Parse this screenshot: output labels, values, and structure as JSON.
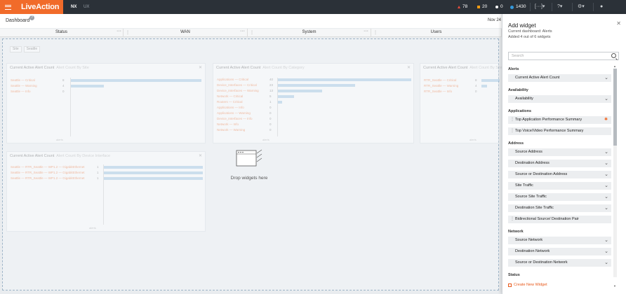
{
  "app": {
    "logo": "LiveAction"
  },
  "topbar": {
    "nav": [
      "NX",
      "UX"
    ],
    "stats": [
      {
        "icon": "alert-triangle-icon",
        "value": "78",
        "color": "#e74c3c"
      },
      {
        "icon": "warning-square-icon",
        "value": "20",
        "color": "#f39c12"
      },
      {
        "icon": "info-circle-icon",
        "value": "0",
        "color": "#ffffff"
      },
      {
        "icon": "users-icon",
        "value": "1430",
        "color": "#3498db"
      }
    ],
    "icons": [
      "expand-icon",
      "help-icon",
      "gear-icon",
      "user-icon"
    ]
  },
  "dashboard": {
    "title": "Dashboard",
    "date": "Nov 24",
    "tabs": [
      "Status",
      "WAN",
      "System",
      "Users"
    ],
    "filters": [
      "Site",
      "Seattle"
    ],
    "drop_text": "Drop widgets here",
    "widgets": [
      {
        "title": "Current Active Alert Count",
        "subtitle": "Alert Count By Site",
        "rows": [
          {
            "label": "Seattle — Critical",
            "value": "8",
            "bar": 1.0
          },
          {
            "label": "Seattle — Warning",
            "value": "4",
            "bar": 0.25
          },
          {
            "label": "Seattle — Info",
            "value": "0",
            "bar": 0.0
          }
        ],
        "footer": "alerts"
      },
      {
        "title": "Current Active Alert Count",
        "subtitle": "Alert Count By Category",
        "rows": [
          {
            "label": "Applications — Critical",
            "value": "40",
            "bar": 1.0
          },
          {
            "label": "Device_Interfaces — Critical",
            "value": "23",
            "bar": 0.58
          },
          {
            "label": "Device_Interfaces — Warning",
            "value": "13",
            "bar": 0.33
          },
          {
            "label": "Network — Critical",
            "value": "5",
            "bar": 0.12
          },
          {
            "label": "Routers — Critical",
            "value": "1",
            "bar": 0.03
          },
          {
            "label": "Applications — Info",
            "value": "0",
            "bar": 0.0
          },
          {
            "label": "Applications — Warning",
            "value": "0",
            "bar": 0.0
          },
          {
            "label": "Device_Interfaces — Info",
            "value": "0",
            "bar": 0.0
          },
          {
            "label": "Network — Info",
            "value": "0",
            "bar": 0.0
          },
          {
            "label": "Network — Warning",
            "value": "0",
            "bar": 0.0
          }
        ],
        "footer": "alerts"
      },
      {
        "title": "Current Active Alert Count",
        "subtitle": "Alert Count By Site",
        "rows": [
          {
            "label": "RTR_Seattle — Critical",
            "value": "8",
            "bar": 1.0
          },
          {
            "label": "RTR_Seattle — Warning",
            "value": "4",
            "bar": 0.3
          },
          {
            "label": "RTR_Seattle — Info",
            "value": "0",
            "bar": 0.0
          }
        ],
        "footer": "alerts"
      },
      {
        "title": "Current Active Alert Count",
        "subtitle": "Alert Count By Device Interface",
        "rows": [
          {
            "label": "Seattle — RTR_Seattle — WP1.2 — GigabitEthernet",
            "value": "1",
            "bar": 1.0
          },
          {
            "label": "Seattle — RTR_Seattle — WP1.2 — GigabitEthernet",
            "value": "1",
            "bar": 1.0
          },
          {
            "label": "Seattle — RTR_Seattle — WP1.2 — GigabitEthernet",
            "value": "1",
            "bar": 1.0
          }
        ],
        "footer": "alerts"
      }
    ]
  },
  "panel": {
    "title": "Add widget",
    "current_dashboard": "Current dashboard: Alerts",
    "added": "Added 4 out of 6 widgets",
    "search_placeholder": "Search",
    "create_label": "Create New Widget",
    "groups": [
      {
        "category": "Alerts",
        "items": [
          {
            "label": "Current Active Alert Count",
            "kind": "dropdown"
          }
        ]
      },
      {
        "category": "Availability",
        "items": [
          {
            "label": "Availability",
            "kind": "dropdown"
          }
        ]
      },
      {
        "category": "Applications",
        "items": [
          {
            "label": "Top Application Performance Summary",
            "kind": "starred"
          },
          {
            "label": "Top Voice/Video Performance Summary",
            "kind": "draggable"
          }
        ]
      },
      {
        "category": "Address",
        "items": [
          {
            "label": "Source Address",
            "kind": "dropdown"
          },
          {
            "label": "Destination Address",
            "kind": "dropdown"
          },
          {
            "label": "Source or Destination Address",
            "kind": "dropdown"
          },
          {
            "label": "Site Traffic",
            "kind": "dropdown"
          },
          {
            "label": "Source Site Traffic",
            "kind": "dropdown"
          },
          {
            "label": "Destination Site Traffic",
            "kind": "dropdown"
          },
          {
            "label": "Bidirectional Source/ Destination Pair",
            "kind": "draggable"
          }
        ]
      },
      {
        "category": "Network",
        "items": [
          {
            "label": "Source Network",
            "kind": "dropdown"
          },
          {
            "label": "Destination Network",
            "kind": "dropdown"
          },
          {
            "label": "Source or Destination Network",
            "kind": "dropdown"
          }
        ]
      },
      {
        "category": "Status",
        "items": []
      }
    ]
  }
}
